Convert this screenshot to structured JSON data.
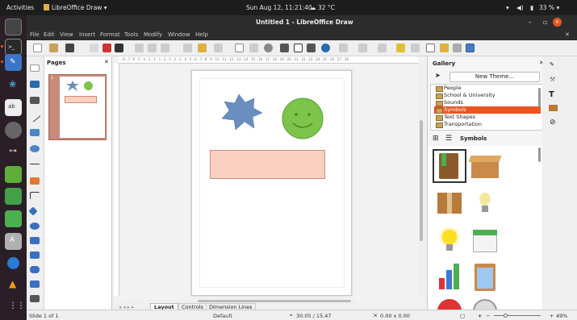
{
  "system": {
    "activities": "Activities",
    "app_name": "LibreOffice Draw ▾",
    "clock": "Sun Aug 12, 11:21:40",
    "weather": "32 °C",
    "battery": "33 % ▾"
  },
  "window": {
    "title": "Untitled 1 - LibreOffice Draw",
    "minimize": "–",
    "maximize": "▫",
    "close": "✕"
  },
  "menu": [
    "File",
    "Edit",
    "View",
    "Insert",
    "Format",
    "Tools",
    "Modify",
    "Window",
    "Help"
  ],
  "menu_close": "✕",
  "pages_panel": {
    "title": "Pages",
    "close": "✕",
    "page_number": "1"
  },
  "ruler_h_text": "· · 8 · 7 · 6 · 5 · 4 · 3 · 2 · 1 · 2 · 1 · 2 · 3 · 4 · 5 · 6 · 7 · 8 · 9 · 10 · 11 · 12 · 13 · 14 · 15 · 16 · 17 · 18 · 19 · 20 · 21 · 22 · 23 · 24 · 25 · 26 · 27 · 28",
  "tabs": {
    "nav": "◂ ◂ ▸ ▸",
    "layout": "Layout",
    "controls": "Controls",
    "dimension_lines": "Dimension Lines"
  },
  "gallery": {
    "title": "Gallery",
    "close": "✕",
    "new_theme": "New Theme...",
    "categories": [
      "People",
      "School & University",
      "Sounds",
      "Symbols",
      "Text Shapes",
      "Transportation"
    ],
    "selected_category": "Symbols",
    "current_theme": "Symbols",
    "icons": [
      "book-icon",
      "open-box-icon",
      "closed-box-icon",
      "lightbulb-off-icon",
      "lightbulb-on-icon",
      "calendar-icon",
      "bar-chart-icon",
      "clipboard-icon",
      "alarm-clock-icon",
      "clock-icon"
    ]
  },
  "status": {
    "slide": "Slide 1 of 1",
    "layout": "Default",
    "position": "30.05 / 15.47",
    "size": "0.00 x 0.00",
    "zoom_minus": "−",
    "zoom_plus": "+",
    "zoom": "49%"
  },
  "colors": {
    "accent": "#e95420",
    "star": "#6a8ec0",
    "smiley": "#7cc44a",
    "rectangle": "#f9d0c0",
    "rectangle_border": "#c98a7a"
  }
}
